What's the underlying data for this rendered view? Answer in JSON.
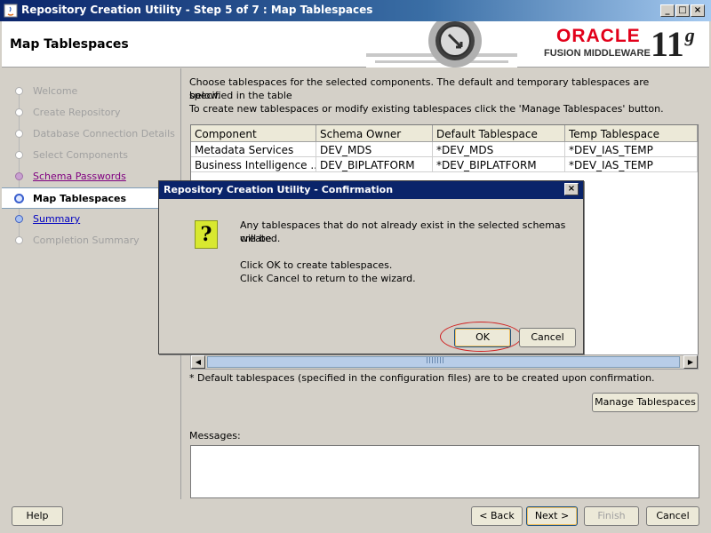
{
  "window": {
    "title": "Repository Creation Utility - Step 5 of 7 : Map Tablespaces",
    "minimize_glyph": "_",
    "maximize_glyph": "□",
    "close_glyph": "×"
  },
  "header": {
    "page_title": "Map Tablespaces",
    "brand_oracle": "ORACLE",
    "brand_sub": "FUSION MIDDLEWARE",
    "version": "11",
    "version_suffix": "g"
  },
  "nav": {
    "items": [
      {
        "label": "Welcome",
        "state": "done"
      },
      {
        "label": "Create Repository",
        "state": "done"
      },
      {
        "label": "Database Connection Details",
        "state": "done"
      },
      {
        "label": "Select Components",
        "state": "done"
      },
      {
        "label": "Schema Passwords",
        "state": "visited"
      },
      {
        "label": "Map Tablespaces",
        "state": "active"
      },
      {
        "label": "Summary",
        "state": "link"
      },
      {
        "label": "Completion Summary",
        "state": "pending"
      }
    ]
  },
  "main": {
    "intro_line1": "Choose tablespaces for the selected components. The default and temporary tablespaces are specified in the table",
    "intro_line2": "below.",
    "intro_line3": "To create new tablespaces or modify existing tablespaces click the 'Manage Tablespaces' button.",
    "table": {
      "columns": [
        "Component",
        "Schema Owner",
        "Default Tablespace",
        "Temp Tablespace"
      ],
      "rows": [
        [
          "Metadata Services",
          "DEV_MDS",
          "*DEV_MDS",
          "*DEV_IAS_TEMP"
        ],
        [
          "Business Intelligence ...",
          "DEV_BIPLATFORM",
          "*DEV_BIPLATFORM",
          "*DEV_IAS_TEMP"
        ]
      ]
    },
    "footnote": "* Default tablespaces (specified in the configuration files) are to be created upon confirmation.",
    "manage_button": "Manage Tablespaces",
    "messages_label": "Messages:"
  },
  "footer": {
    "help": "Help",
    "back": "< Back",
    "next": "Next >",
    "finish": "Finish",
    "cancel": "Cancel"
  },
  "dialog": {
    "title": "Repository Creation Utility - Confirmation",
    "close_glyph": "×",
    "icon_glyph": "?",
    "line1": "Any tablespaces that do not already exist in the selected schemas will be",
    "line2": "created.",
    "line3": "Click OK to create tablespaces.",
    "line4": "Click Cancel to return to the wizard.",
    "ok": "OK",
    "cancel": "Cancel"
  },
  "colors": {
    "title_bar": "#0a246a",
    "oracle_red": "#e2001a",
    "active_step": "#3a5fcd",
    "highlight_ring": "#d02020"
  }
}
